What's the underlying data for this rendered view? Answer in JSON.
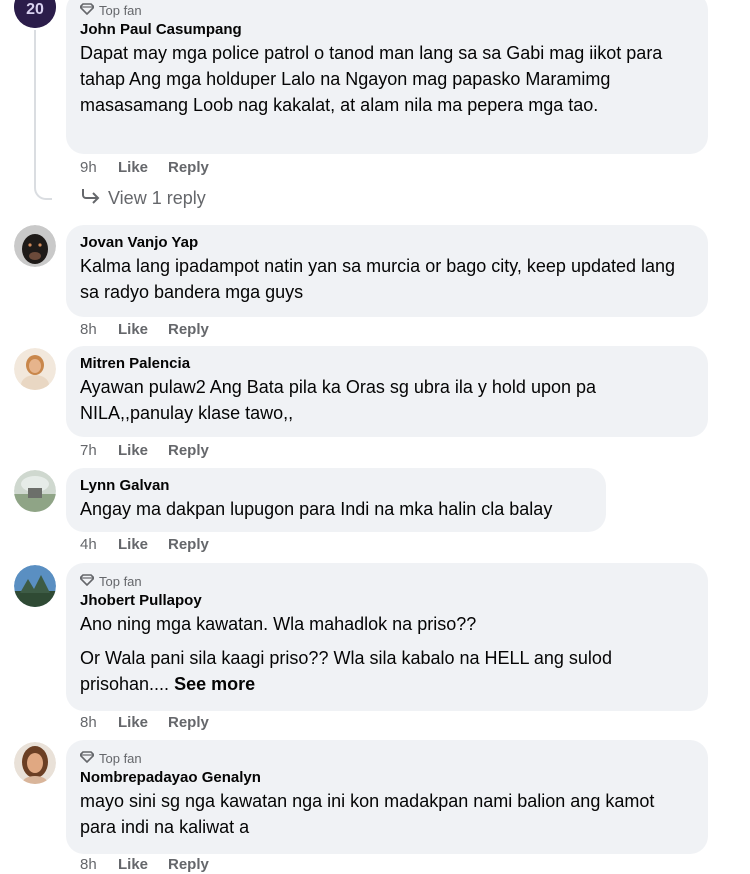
{
  "comments": [
    {
      "badge": "Top fan",
      "author": "John Paul Casumpang",
      "text": [
        "Dapat may mga police patrol o tanod man lang sa sa Gabi mag iikot para tahap Ang mga holduper Lalo na Ngayon mag papasko Maramimg masasamang Loob nag kakalat, at alam nila ma pepera mga tao."
      ],
      "time": "9h",
      "like": "Like",
      "reply": "Reply",
      "avatar_text": "20"
    },
    {
      "author": "Jovan Vanjo Yap",
      "text": [
        "Kalma lang ipadampot natin yan sa murcia or bago city, keep updated lang sa radyo bandera mga guys"
      ],
      "time": "8h",
      "like": "Like",
      "reply": "Reply"
    },
    {
      "author": "Mitren Palencia",
      "text": [
        "Ayawan pulaw2 Ang Bata pila ka Oras sg ubra ila y hold upon pa NILA,,panulay klase tawo,,"
      ],
      "time": "7h",
      "like": "Like",
      "reply": "Reply"
    },
    {
      "author": "Lynn Galvan",
      "text": [
        "Angay ma dakpan lupugon para Indi na mka halin cla balay"
      ],
      "time": "4h",
      "like": "Like",
      "reply": "Reply"
    },
    {
      "badge": "Top fan",
      "author": "Jhobert Pullapoy",
      "text": [
        "Ano ning mga kawatan. Wla mahadlok na priso??",
        "Or Wala pani sila kaagi priso?? Wla sila kabalo na HELL ang sulod prisohan...."
      ],
      "see_more": "See more",
      "time": "8h",
      "like": "Like",
      "reply": "Reply"
    },
    {
      "badge": "Top fan",
      "author": "Nombrepadayao Genalyn",
      "text": [
        "mayo sini sg nga kawatan nga ini kon madakpan nami balion ang kamot para indi na kaliwat a"
      ],
      "time": "8h",
      "like": "Like",
      "reply": "Reply"
    }
  ],
  "view_reply": "View 1 reply"
}
